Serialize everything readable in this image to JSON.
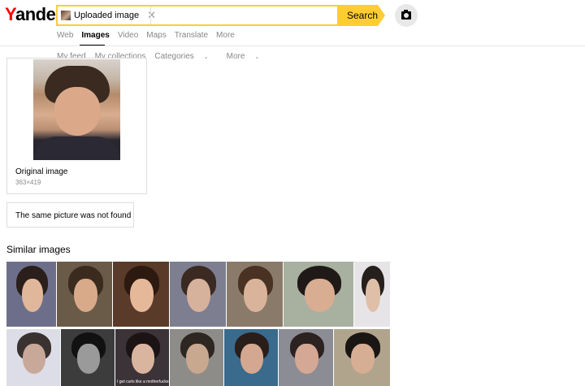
{
  "logo": "Yandex",
  "search": {
    "chip_label": "Uploaded image",
    "button_label": "Search"
  },
  "tabs": [
    "Web",
    "Images",
    "Video",
    "Maps",
    "Translate",
    "More"
  ],
  "active_tab": "Images",
  "subnav": [
    "My feed",
    "My collections",
    "Categories",
    "More"
  ],
  "original": {
    "title": "Original image",
    "size": "363×419"
  },
  "not_found": "The same picture was not found",
  "similar_title": "Similar images",
  "similar_tiles": [
    {
      "bg": "#6d6f8a",
      "hair": "#2a1f1a",
      "face": "#e1b79c",
      "caption": ""
    },
    {
      "bg": "#6a5a48",
      "hair": "#3b2b1e",
      "face": "#d8aa8a",
      "caption": ""
    },
    {
      "bg": "#5a3a28",
      "hair": "#2c1a10",
      "face": "#e6b89a",
      "caption": ""
    },
    {
      "bg": "#7d7e90",
      "hair": "#3a2a22",
      "face": "#d6b29c",
      "caption": ""
    },
    {
      "bg": "#8a7a6a",
      "hair": "#4a3222",
      "face": "#d9b49a",
      "caption": ""
    },
    {
      "bg": "#a8b0a0",
      "hair": "#1f1a18",
      "face": "#d8ad92",
      "caption": ""
    },
    {
      "bg": "#e6e4e6",
      "hair": "#26201c",
      "face": "#dfbfa8",
      "caption": ""
    },
    {
      "bg": "#dcdde6",
      "hair": "#3a3230",
      "face": "#c8a898",
      "caption": ""
    },
    {
      "bg": "#3c3c3c",
      "hair": "#111111",
      "face": "#9a9a9a",
      "caption": ""
    },
    {
      "bg": "#3b3338",
      "hair": "#1c1414",
      "face": "#d9b5a0",
      "caption": "I get curls like a motherfucker"
    },
    {
      "bg": "#8d8c88",
      "hair": "#2e2620",
      "face": "#c9a890",
      "caption": ""
    },
    {
      "bg": "#3a6a8c",
      "hair": "#2a1e1a",
      "face": "#d4a890",
      "caption": ""
    },
    {
      "bg": "#8c8c94",
      "hair": "#2c2220",
      "face": "#d4a894",
      "caption": ""
    },
    {
      "bg": "#b0a48c",
      "hair": "#1a1614",
      "face": "#d6ae94",
      "caption": ""
    }
  ]
}
